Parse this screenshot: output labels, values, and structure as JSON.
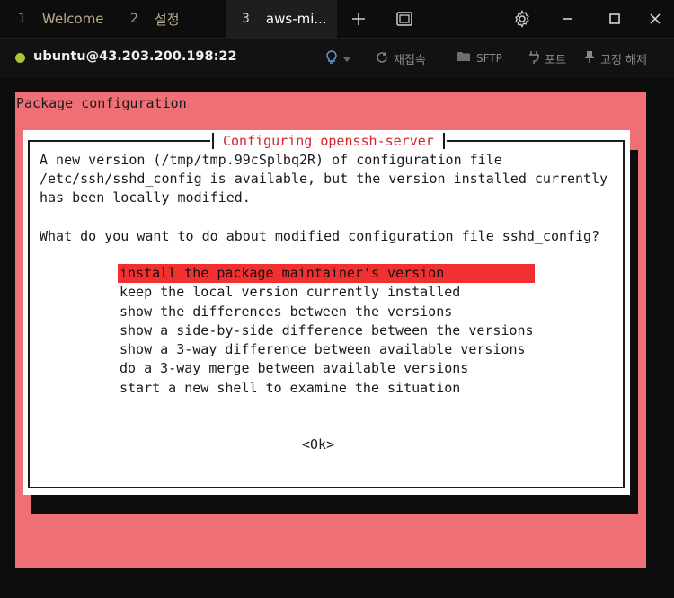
{
  "tabs": [
    {
      "num": "1",
      "label": "Welcome"
    },
    {
      "num": "2",
      "label": "설정"
    },
    {
      "num": "3",
      "label": "aws-mi..."
    }
  ],
  "connection": {
    "host": "ubuntu@43.203.200.198:22",
    "reconnect": "재접속",
    "sftp": "SFTP",
    "port": "포트",
    "unpin": "고정 해제"
  },
  "terminal": {
    "package_title": "Package configuration",
    "dialog": {
      "title": "Configuring openssh-server",
      "message_lines": [
        "A new version (/tmp/tmp.99cSplbq2R) of configuration file",
        "/etc/ssh/sshd_config is available, but the version installed currently",
        "has been locally modified."
      ],
      "question": "What do you want to do about modified configuration file sshd_config?",
      "options": [
        "install the package maintainer's version",
        "keep the local version currently installed",
        "show the differences between the versions",
        "show a side-by-side difference between the versions",
        "show a 3-way difference between available versions",
        "do a 3-way merge between available versions",
        "start a new shell to examine the situation"
      ],
      "selected_index": 0,
      "ok_label": "<Ok>"
    }
  },
  "colors": {
    "accent_red": "#f2302f",
    "background_pink": "#ef6f76",
    "status_dot": "#b3c23a"
  }
}
